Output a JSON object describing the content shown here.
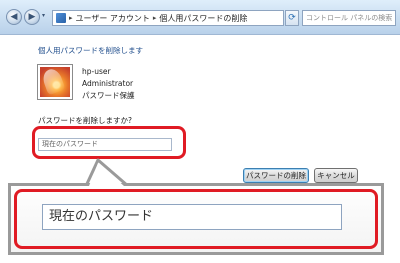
{
  "address_bar": {
    "back_glyph": "◀",
    "forward_glyph": "▶",
    "history_glyph": "▾",
    "crumb_separator": "▸",
    "crumbs": [
      "ユーザー アカウント",
      "個人用パスワードの削除"
    ],
    "refresh_glyph": "⟳",
    "search_placeholder": "コントロール パネルの検索",
    "search_glyph": "⚲"
  },
  "main": {
    "title": "個人用パスワードを削除します",
    "user": {
      "name": "hp-user",
      "role": "Administrator",
      "status": "パスワード保護"
    },
    "question": "パスワードを削除しますか?",
    "password_placeholder": "現在のパスワード",
    "delete_button": "パスワードの削除",
    "cancel_button": "キャンセル"
  },
  "zoom": {
    "password_placeholder": "現在のパスワード"
  },
  "colors": {
    "highlight": "#e01b24",
    "link_title": "#1f4d8c"
  }
}
